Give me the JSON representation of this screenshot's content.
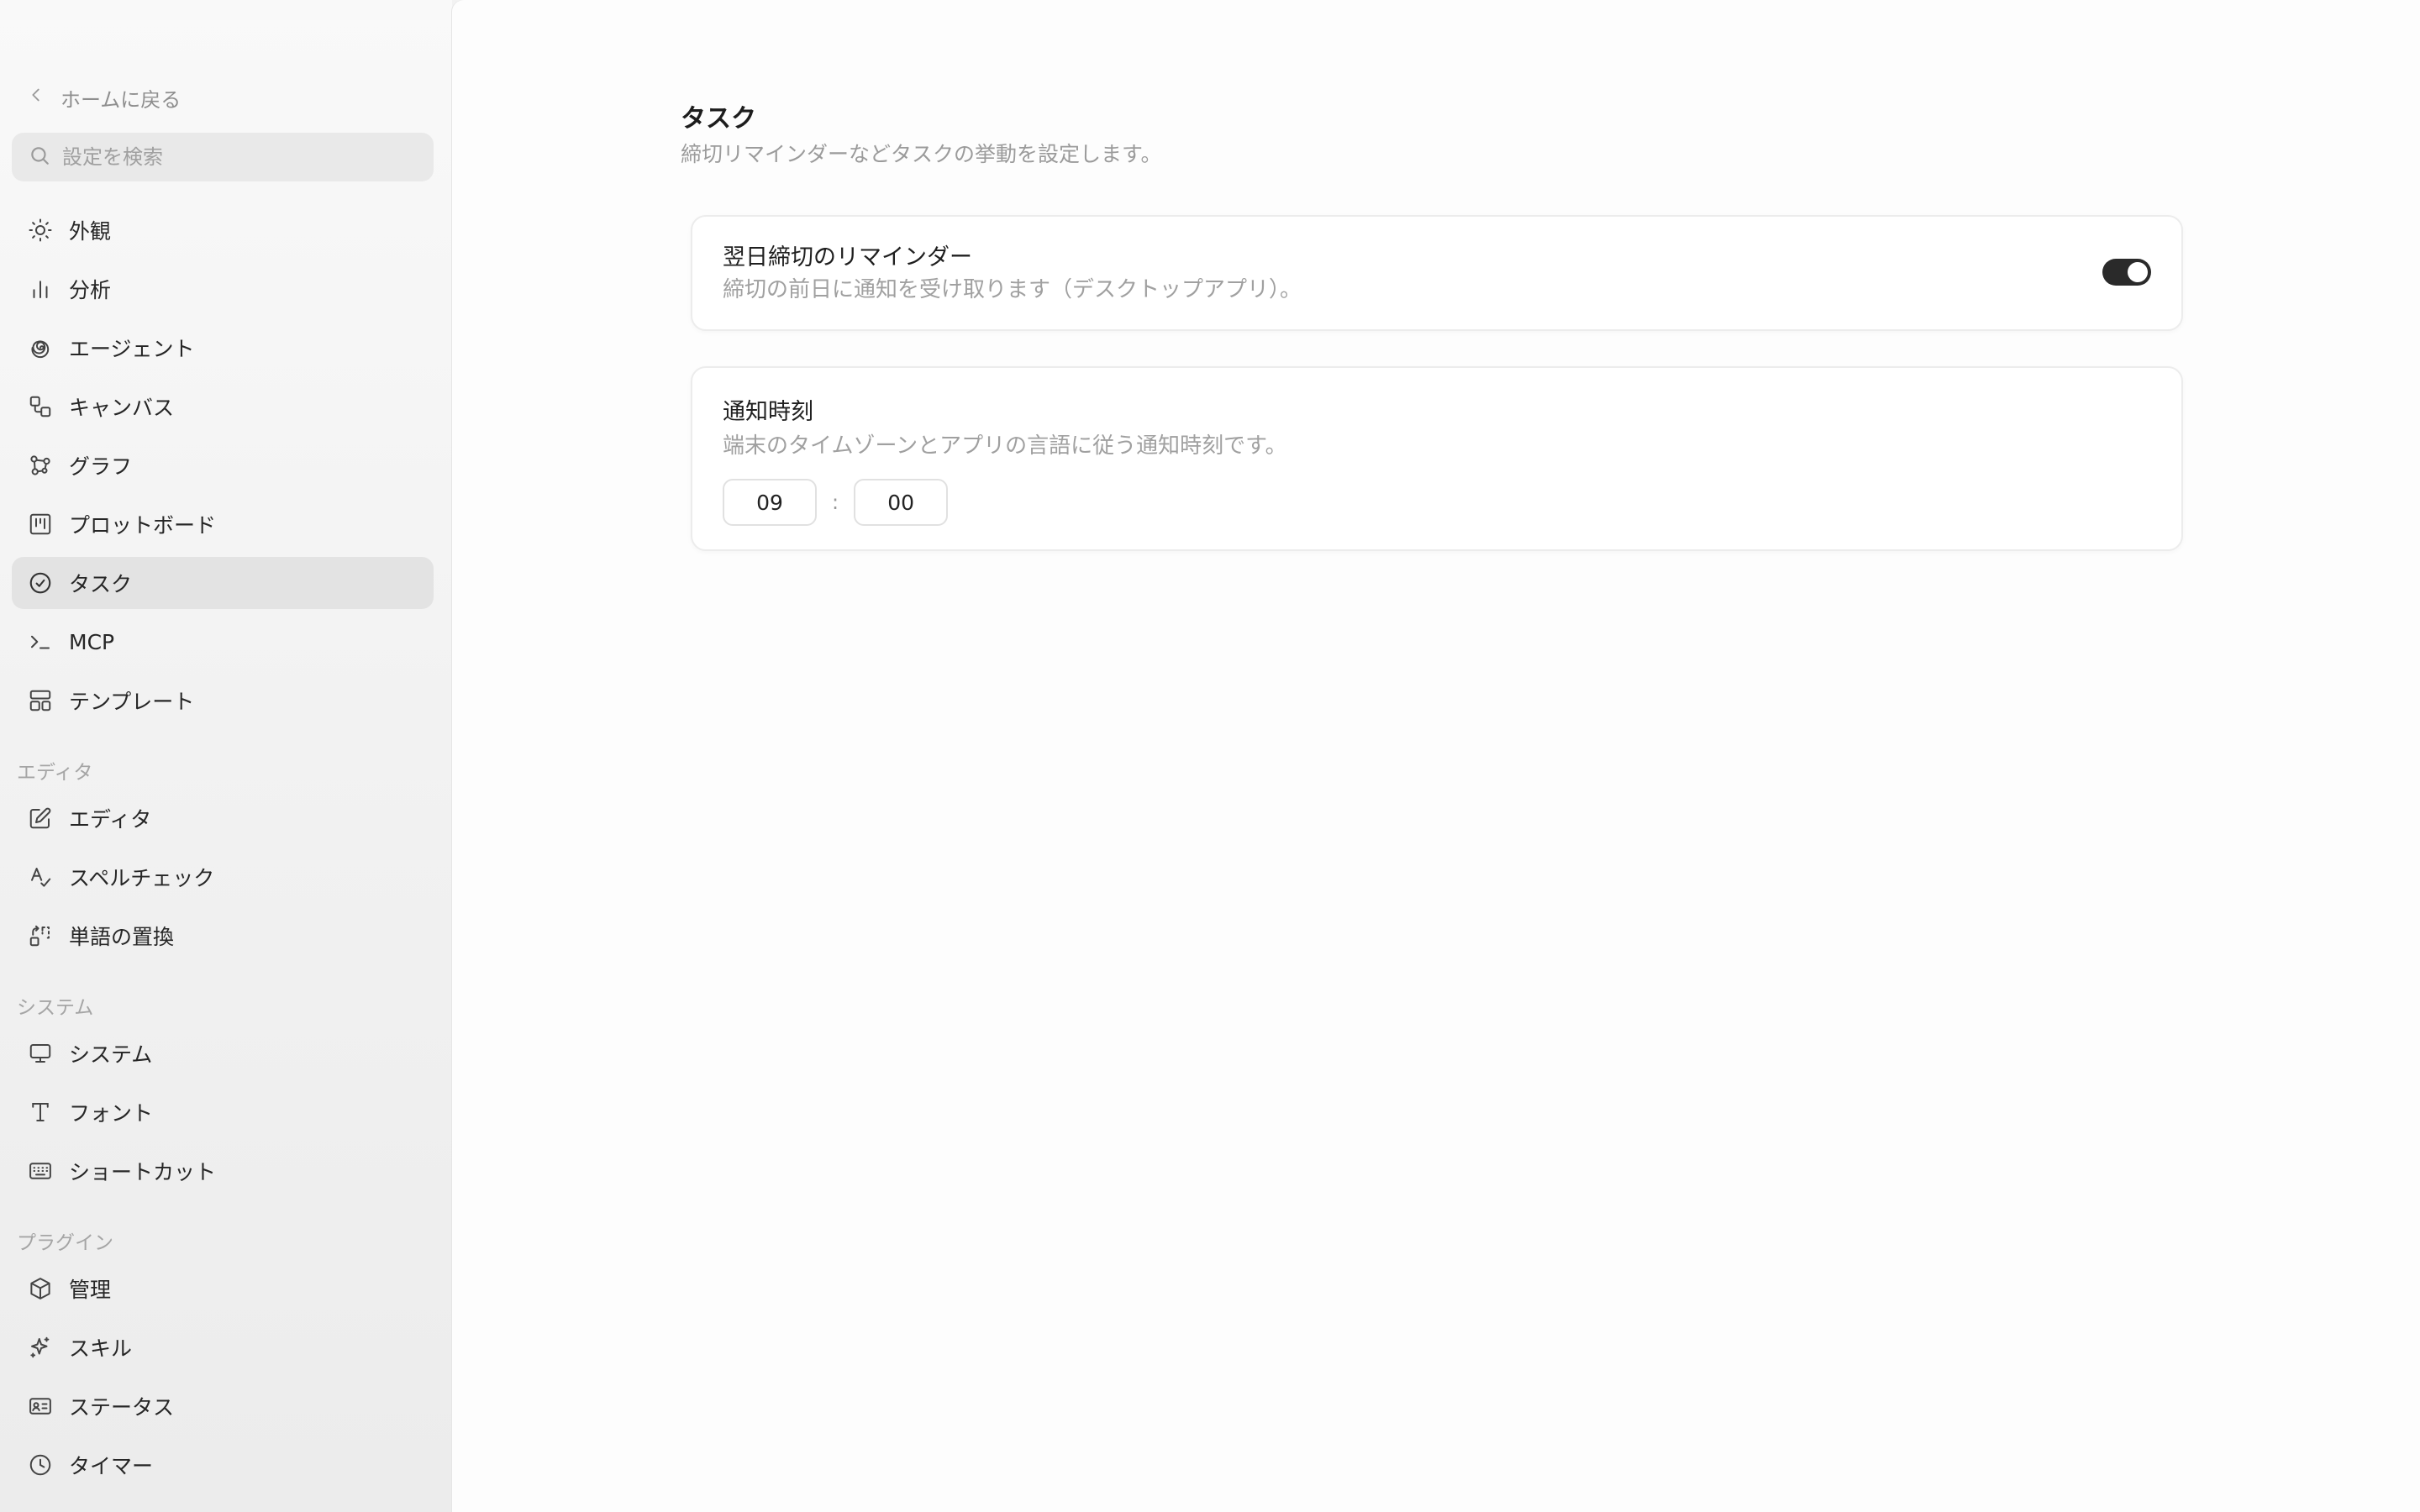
{
  "sidebar": {
    "back_label": "ホームに戻る",
    "search_placeholder": "設定を検索",
    "items": [
      {
        "label": "外観",
        "icon": "sun-icon"
      },
      {
        "label": "分析",
        "icon": "bar-chart-icon"
      },
      {
        "label": "エージェント",
        "icon": "spiral-icon"
      },
      {
        "label": "キャンバス",
        "icon": "canvas-shapes-icon"
      },
      {
        "label": "グラフ",
        "icon": "graph-nodes-icon"
      },
      {
        "label": "プロットボード",
        "icon": "kanban-board-icon"
      },
      {
        "label": "タスク",
        "icon": "check-circle-icon",
        "active": true
      },
      {
        "label": "MCP",
        "icon": "terminal-prompt-icon"
      },
      {
        "label": "テンプレート",
        "icon": "layout-template-icon"
      }
    ],
    "sections": [
      {
        "label": "エディタ",
        "items": [
          {
            "label": "エディタ",
            "icon": "edit-square-icon"
          },
          {
            "label": "スペルチェック",
            "icon": "spell-check-icon"
          },
          {
            "label": "単語の置換",
            "icon": "replace-icon"
          }
        ]
      },
      {
        "label": "システム",
        "items": [
          {
            "label": "システム",
            "icon": "monitor-icon"
          },
          {
            "label": "フォント",
            "icon": "type-icon"
          },
          {
            "label": "ショートカット",
            "icon": "keyboard-icon"
          }
        ]
      },
      {
        "label": "プラグイン",
        "items": [
          {
            "label": "管理",
            "icon": "package-icon"
          },
          {
            "label": "スキル",
            "icon": "sparkle-icon"
          },
          {
            "label": "ステータス",
            "icon": "id-card-icon"
          },
          {
            "label": "タイマー",
            "icon": "clock-icon"
          }
        ]
      }
    ]
  },
  "main": {
    "title": "タスク",
    "subtitle": "締切リマインダーなどタスクの挙動を設定します。",
    "reminder": {
      "title": "翌日締切のリマインダー",
      "description": "締切の前日に通知を受け取ります（デスクトップアプリ）。",
      "enabled": true
    },
    "notify_time": {
      "title": "通知時刻",
      "description": "端末のタイムゾーンとアプリの言語に従う通知時刻です。",
      "hour": "09",
      "separator": ":",
      "minute": "00"
    }
  },
  "colors": {
    "toggle_on": "#2a2a2a",
    "active_item_bg": "#e3e3e3",
    "muted_text": "#a0a0a0"
  }
}
